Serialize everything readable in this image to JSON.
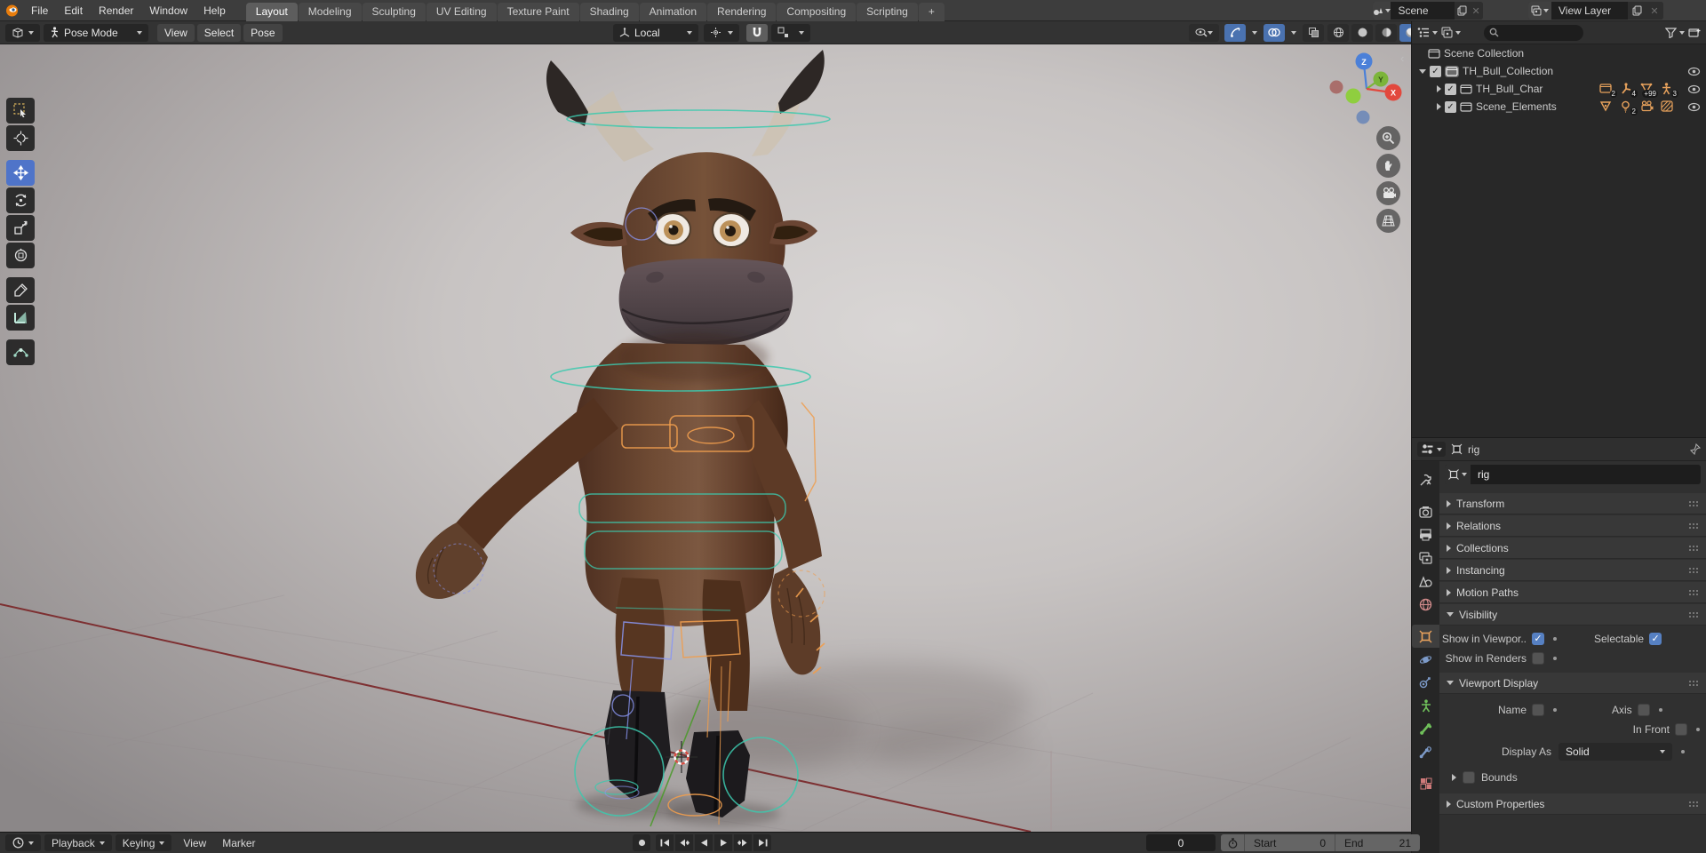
{
  "topbar": {
    "menus": [
      "File",
      "Edit",
      "Render",
      "Window",
      "Help"
    ],
    "tabs": [
      "Layout",
      "Modeling",
      "Sculpting",
      "UV Editing",
      "Texture Paint",
      "Shading",
      "Animation",
      "Rendering",
      "Compositing",
      "Scripting",
      "+"
    ],
    "scene_selector": {
      "value": "Scene"
    },
    "view_layer_selector": {
      "value": "View Layer"
    }
  },
  "viewport_header": {
    "mode": "Pose Mode",
    "menus": [
      "View",
      "Select",
      "Pose"
    ],
    "orientation": "Local"
  },
  "gizmo": {
    "x": "X",
    "y": "Y",
    "z": "Z"
  },
  "outliner": {
    "rows": [
      {
        "label": "Scene Collection"
      },
      {
        "label": "TH_Bull_Collection"
      },
      {
        "label": "TH_Bull_Char",
        "badges": [
          {
            "count": "2"
          },
          {
            "count": "4"
          },
          {
            "count": "+99"
          },
          {
            "count": "3"
          }
        ]
      },
      {
        "label": "Scene_Elements",
        "badges": [
          {
            "count": ""
          },
          {
            "count": "2"
          },
          {
            "count": ""
          },
          {
            "count": ""
          }
        ]
      }
    ]
  },
  "properties": {
    "breadcrumb": "rig",
    "name_value": "rig",
    "panels": [
      "Transform",
      "Relations",
      "Collections",
      "Instancing",
      "Motion Paths"
    ],
    "visibility": {
      "title": "Visibility",
      "show_in_viewport": "Show in Viewpor..",
      "selectable": "Selectable",
      "show_in_renders": "Show in Renders"
    },
    "viewport_display": {
      "title": "Viewport Display",
      "name": "Name",
      "axis": "Axis",
      "in_front": "In Front",
      "display_as": "Display As",
      "display_as_value": "Solid",
      "bounds": "Bounds"
    },
    "custom_properties": "Custom Properties"
  },
  "timeline": {
    "menus": [
      "Playback",
      "Keying",
      "View",
      "Marker"
    ],
    "current_frame": "0",
    "start_label": "Start",
    "start_value": "0",
    "end_label": "End",
    "end_value": "21"
  },
  "colors": {
    "accent_blue": "#4a72b0",
    "checkbox_blue": "#5680c2",
    "selection_orange": "#e8a25c",
    "rig_teal": "#3cc9ae",
    "rig_orange": "#ef9d4e",
    "rig_blue": "#8a96f2",
    "axis_x_red": "#e2483d",
    "axis_y_green": "#7cb53a",
    "axis_z_blue": "#4b80d8",
    "floor_axis_red": "#7a2426"
  }
}
